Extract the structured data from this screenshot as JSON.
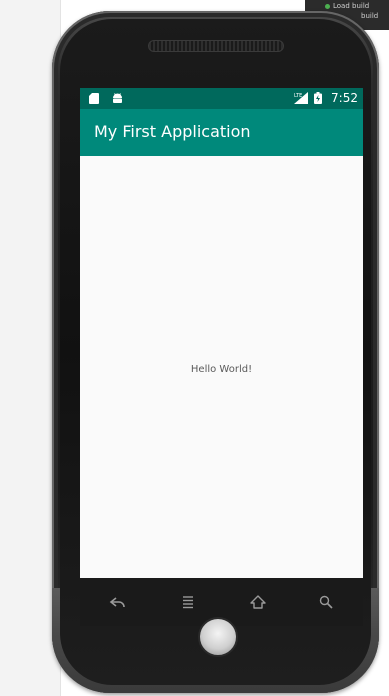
{
  "ide": {
    "line1": "Load build",
    "line2": "build"
  },
  "device": {
    "status_bar": {
      "time": "7:52",
      "left_icons": [
        "sd-card-icon",
        "android-icon"
      ],
      "right_icons": [
        "signal-icon",
        "battery-icon"
      ]
    },
    "app_bar": {
      "title": "My First Application"
    },
    "content": {
      "text": "Hello World!"
    },
    "nav_bar": {
      "buttons": [
        "back-icon",
        "menu-icon",
        "home-icon",
        "search-icon"
      ]
    }
  },
  "colors": {
    "status_bar": "#00695c",
    "app_bar": "#00897b",
    "screen_bg": "#fafafa"
  }
}
